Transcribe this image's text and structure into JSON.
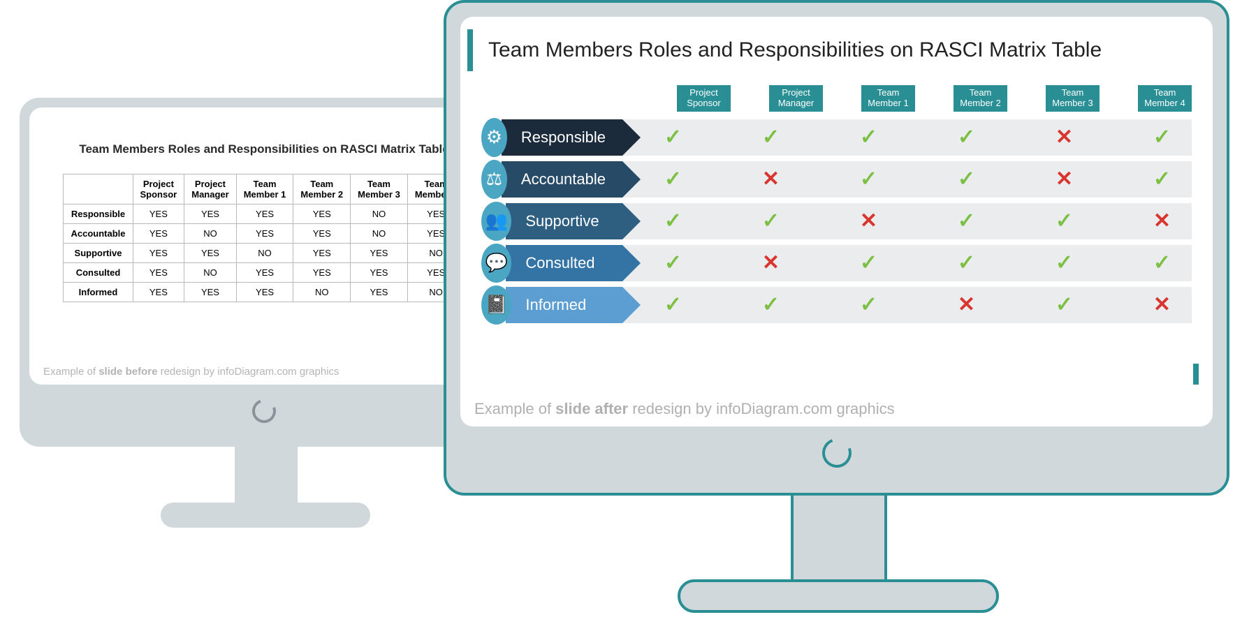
{
  "title": "Team Members Roles and Responsibilities on RASCI Matrix Table",
  "columns": [
    "Project\nSponsor",
    "Project\nManager",
    "Team\nMember 1",
    "Team\nMember 2",
    "Team\nMember 3",
    "Team\nMember 4"
  ],
  "roles": [
    "Responsible",
    "Accountable",
    "Supportive",
    "Consulted",
    "Informed"
  ],
  "role_colors": [
    "#1c2b3b",
    "#274a66",
    "#2e5e80",
    "#3474a4",
    "#5d9ed2"
  ],
  "matrix": [
    [
      true,
      true,
      true,
      true,
      false,
      true
    ],
    [
      true,
      false,
      true,
      true,
      false,
      true
    ],
    [
      true,
      true,
      false,
      true,
      true,
      false
    ],
    [
      true,
      false,
      true,
      true,
      true,
      true
    ],
    [
      true,
      true,
      true,
      false,
      true,
      false
    ]
  ],
  "caption_before_prefix": "Example of ",
  "caption_before_bold": "slide before",
  "caption_before_suffix": " redesign by infoDiagram.com graphics",
  "caption_after_prefix": "Example of ",
  "caption_after_bold": "slide after",
  "caption_after_suffix": " redesign by infoDiagram.com graphics",
  "yes": "YES",
  "no": "NO"
}
